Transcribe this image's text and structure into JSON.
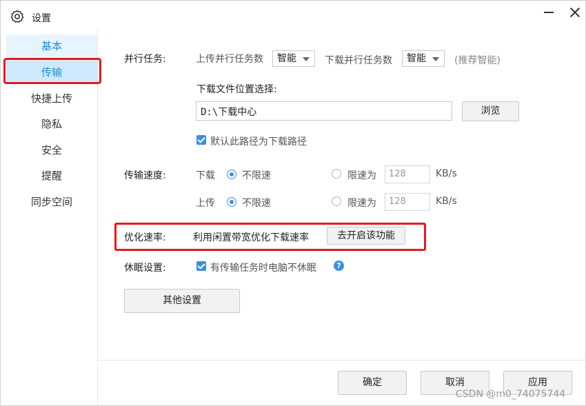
{
  "window": {
    "title": "设置"
  },
  "sidebar": {
    "items": [
      {
        "label": "基本"
      },
      {
        "label": "传输"
      },
      {
        "label": "快捷上传"
      },
      {
        "label": "隐私"
      },
      {
        "label": "安全"
      },
      {
        "label": "提醒"
      },
      {
        "label": "同步空间"
      }
    ]
  },
  "parallel": {
    "label": "并行任务:",
    "upload_label": "上传并行任务数",
    "upload_value": "智能",
    "download_label": "下载并行任务数",
    "download_value": "智能",
    "hint": "(推荐智能)"
  },
  "download_location": {
    "label": "下载文件位置选择:",
    "path": "D:\\下载中心",
    "browse_label": "浏览",
    "default_checkbox_label": "默认此路径为下载路径"
  },
  "speed": {
    "label": "传输速度:",
    "download": {
      "label": "下载",
      "unlimited_label": "不限速",
      "limit_label": "限速为",
      "limit_value": "128",
      "unit": "KB/s"
    },
    "upload": {
      "label": "上传",
      "unlimited_label": "不限速",
      "limit_label": "限速为",
      "limit_value": "128",
      "unit": "KB/s"
    }
  },
  "optimize": {
    "label": "优化速率:",
    "description": "利用闲置带宽优化下载速率",
    "button_label": "去开启该功能"
  },
  "sleep": {
    "label": "休眠设置:",
    "checkbox_label": "有传输任务时电脑不休眠"
  },
  "other_settings_label": "其他设置",
  "footer": {
    "ok_label": "确定",
    "cancel_label": "取消",
    "apply_label": "应用"
  },
  "watermark": "CSDN @m0_74075744",
  "colors": {
    "accent": "#3b8fe0",
    "highlight_box": "#e8161c",
    "sidebar_selected": "#cde9fb"
  }
}
